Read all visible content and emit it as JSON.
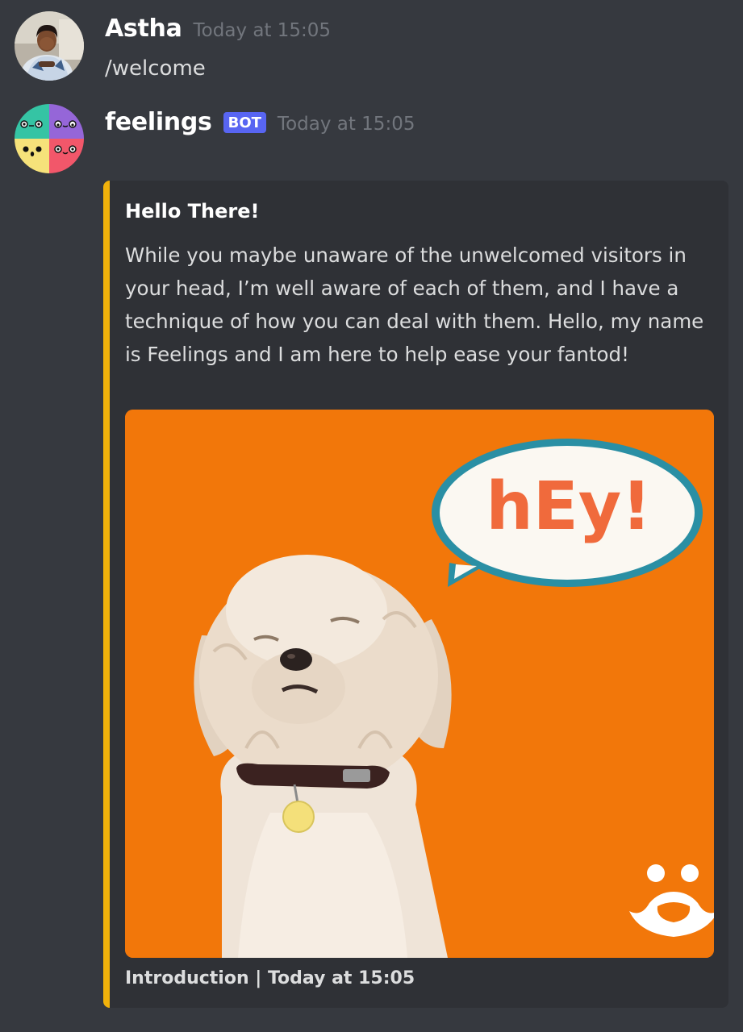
{
  "messages": [
    {
      "username": "Astha",
      "timestamp": "Today at 15:05",
      "text": "/welcome"
    },
    {
      "username": "feelings",
      "badge": "BOT",
      "timestamp": "Today at 15:05",
      "embed": {
        "accent_color": "#f1b20b",
        "title": "Hello There!",
        "description": "While you maybe unaware of the unwelcomed visitors in your head, I’m well aware of each of them, and I have a technique of how you can deal with them. Hello, my name is Feelings and I am here to help ease your fantod!",
        "image": {
          "speech_bubble_text": "hEy!",
          "background_color": "#f2770a"
        },
        "footer": "Introduction | Today at 15:05"
      }
    }
  ],
  "colors": {
    "background": "#36393f",
    "embed_background": "#2f3136",
    "bot_badge": "#5865f2",
    "timestamp": "#72767d"
  }
}
